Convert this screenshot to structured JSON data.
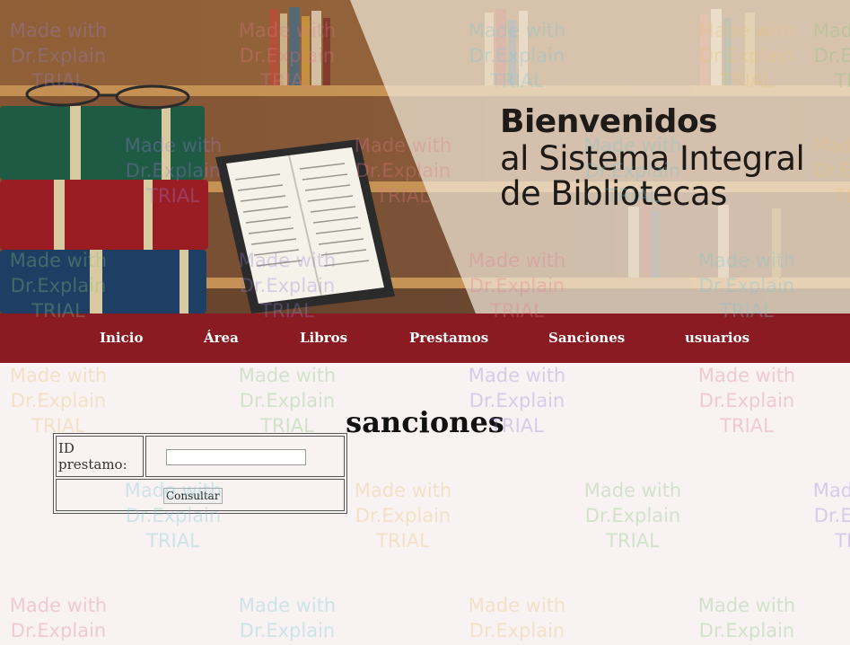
{
  "banner": {
    "line1": "Bienvenidos",
    "line2": "al Sistema Integral",
    "line3": "de Bibliotecas"
  },
  "nav": {
    "items": [
      {
        "label": "Inicio"
      },
      {
        "label": "Área"
      },
      {
        "label": "Libros"
      },
      {
        "label": "Prestamos"
      },
      {
        "label": "Sanciones"
      },
      {
        "label": "usuarios"
      }
    ]
  },
  "page": {
    "title": "sanciones"
  },
  "form": {
    "loan_id_label": "ID prestamo:",
    "loan_id_value": "",
    "submit_label": "Consultar"
  },
  "watermark": {
    "line1": "Made with",
    "line2": "Dr.Explain",
    "line3": "TRIAL"
  },
  "colors": {
    "nav_background": "#8a1b22",
    "page_background": "#f8f2f2",
    "nav_text": "#ffffff"
  }
}
